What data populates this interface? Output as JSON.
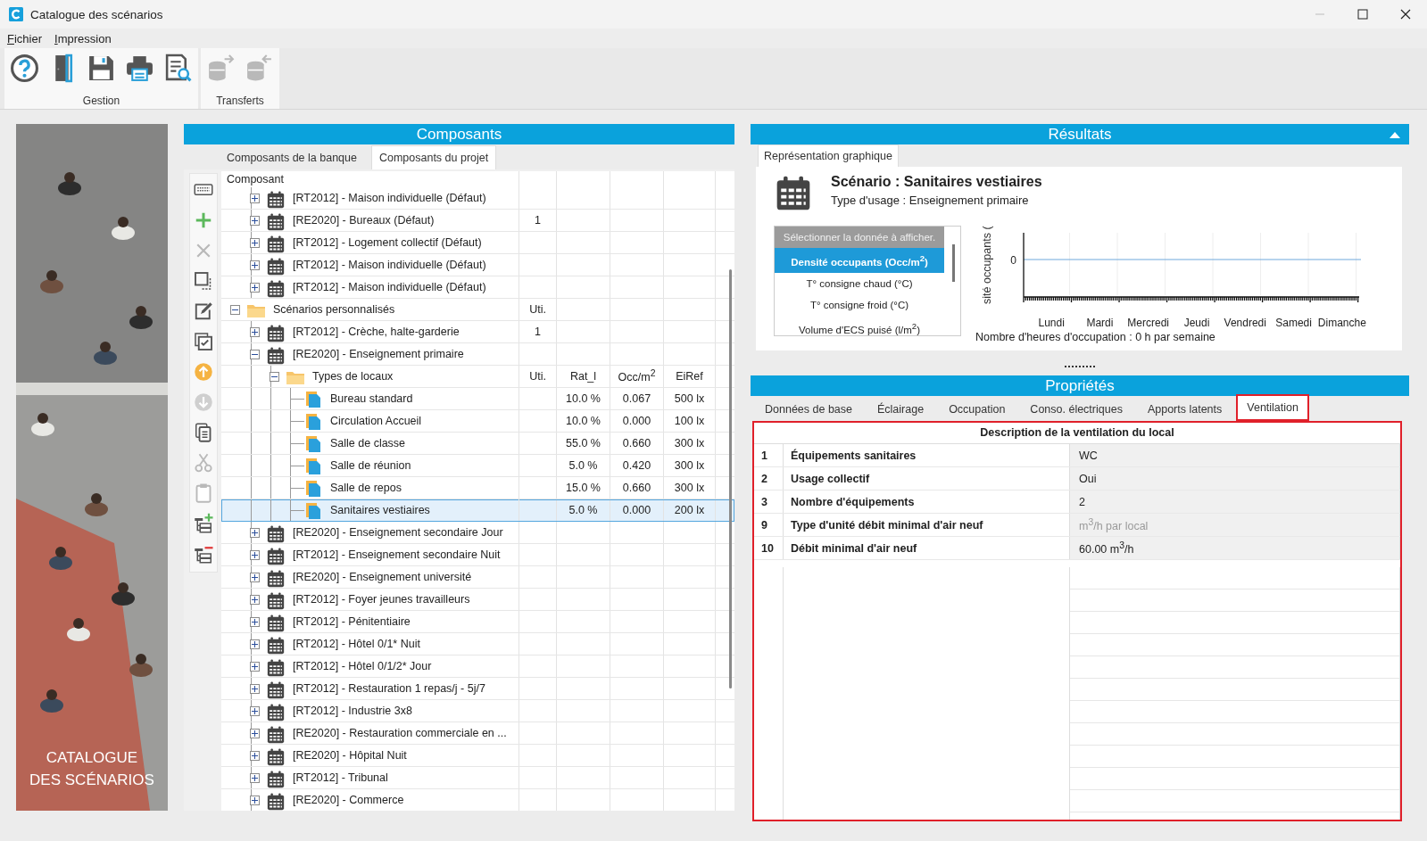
{
  "window": {
    "title": "Catalogue des scénarios"
  },
  "menu": [
    {
      "label": "Fichier"
    },
    {
      "label": "Impression"
    }
  ],
  "toolbar": [
    {
      "label": "Gestion",
      "tools": [
        {
          "kind": "help",
          "disabled": false
        },
        {
          "kind": "door",
          "disabled": false
        },
        {
          "kind": "save",
          "disabled": false
        },
        {
          "kind": "print",
          "disabled": false
        },
        {
          "kind": "preview",
          "disabled": false
        }
      ]
    },
    {
      "label": "Transferts",
      "tools": [
        {
          "kind": "export",
          "disabled": true
        },
        {
          "kind": "import",
          "disabled": true
        }
      ]
    }
  ],
  "side_banner": {
    "kind": "picture",
    "title_lines": [
      "CATALOGUE",
      "DES SCÉNARIOS"
    ]
  },
  "composants": {
    "title": "Composants",
    "tabs": [
      {
        "label": "Composants de la banque",
        "selected": false
      },
      {
        "label": "Composants du projet",
        "selected": true
      }
    ],
    "tools": [
      {
        "kind": "keyboard",
        "disabled": false
      },
      {
        "kind": "add",
        "disabled": false
      },
      {
        "kind": "delete",
        "disabled": true
      },
      {
        "kind": "select",
        "disabled": false
      },
      {
        "kind": "edit",
        "disabled": false
      },
      {
        "kind": "check",
        "disabled": false
      },
      {
        "kind": "up",
        "disabled": false
      },
      {
        "kind": "down",
        "disabled": true
      },
      {
        "kind": "copy",
        "disabled": false
      },
      {
        "kind": "cut",
        "disabled": true
      },
      {
        "kind": "paste",
        "disabled": true
      },
      {
        "kind": "tree-add",
        "disabled": false
      },
      {
        "kind": "tree-remove",
        "disabled": false
      }
    ],
    "tree": {
      "column_heading": "Composant",
      "top_items": [
        {
          "kind": "calendar",
          "label": "[RT2012] - Maison individuelle (Défaut)",
          "expanded": false,
          "selected": false
        },
        {
          "kind": "calendar",
          "label": "[RE2020] - Bureaux (Défaut)",
          "uti": "1",
          "expanded": false,
          "selected": false
        },
        {
          "kind": "calendar",
          "label": "[RT2012] - Logement collectif (Défaut)",
          "expanded": false,
          "selected": false
        },
        {
          "kind": "calendar",
          "label": "[RT2012] - Maison individuelle (Défaut)",
          "expanded": false,
          "selected": false
        },
        {
          "kind": "calendar",
          "label": "[RT2012] - Maison individuelle (Défaut)",
          "expanded": false,
          "selected": false
        }
      ],
      "folders": [
        {
          "kind": "folder",
          "label": "Scénarios personnalisés",
          "column_headings": [
            "Uti."
          ],
          "expanded": true,
          "selected": false,
          "children": [
            {
              "kind": "calendar",
              "label": "[RT2012] - Crèche, halte-garderie",
              "uti": "1",
              "expanded": false,
              "selected": false
            },
            {
              "kind": "calendar",
              "label": "[RE2020] - Enseignement primaire",
              "expanded": true,
              "selected": false,
              "children": [
                {
                  "kind": "folder",
                  "label": "Types de locaux",
                  "column_headings": [
                    "Uti.",
                    "Rat_l",
                    "Occ/m$^{2}$",
                    "EiRef"
                  ],
                  "expanded": true,
                  "selected": false,
                  "children": [
                    {
                      "kind": "local",
                      "label": "Bureau standard",
                      "rat_l": "10.0 %",
                      "occ_m2": "0.067",
                      "eiref": "500 lx",
                      "selected": false
                    },
                    {
                      "kind": "local",
                      "label": "Circulation Accueil",
                      "rat_l": "10.0 %",
                      "occ_m2": "0.000",
                      "eiref": "100 lx",
                      "selected": false
                    },
                    {
                      "kind": "local",
                      "label": "Salle de classe",
                      "rat_l": "55.0 %",
                      "occ_m2": "0.660",
                      "eiref": "300 lx",
                      "selected": false
                    },
                    {
                      "kind": "local",
                      "label": "Salle de réunion",
                      "rat_l": "5.0 %",
                      "occ_m2": "0.420",
                      "eiref": "300 lx",
                      "selected": false
                    },
                    {
                      "kind": "local",
                      "label": "Salle de repos",
                      "rat_l": "15.0 %",
                      "occ_m2": "0.660",
                      "eiref": "300 lx",
                      "selected": false
                    },
                    {
                      "kind": "local",
                      "label": "Sanitaires vestiaires",
                      "rat_l": "5.0 %",
                      "occ_m2": "0.000",
                      "eiref": "200 lx",
                      "selected": true
                    }
                  ]
                }
              ]
            },
            {
              "kind": "calendar",
              "label": "[RE2020] - Enseignement secondaire Jour",
              "expanded": false,
              "selected": false
            },
            {
              "kind": "calendar",
              "label": "[RT2012] - Enseignement secondaire Nuit",
              "expanded": false,
              "selected": false
            },
            {
              "kind": "calendar",
              "label": "[RE2020] - Enseignement université",
              "expanded": false,
              "selected": false
            },
            {
              "kind": "calendar",
              "label": "[RT2012] - Foyer jeunes travailleurs",
              "expanded": false,
              "selected": false
            },
            {
              "kind": "calendar",
              "label": "[RT2012] - Pénitentiaire",
              "expanded": false,
              "selected": false
            },
            {
              "kind": "calendar",
              "label": "[RT2012] - Hôtel 0/1* Nuit",
              "expanded": false,
              "selected": false
            },
            {
              "kind": "calendar",
              "label": "[RT2012] - Hôtel 0/1/2* Jour",
              "expanded": false,
              "selected": false
            },
            {
              "kind": "calendar",
              "label": "[RT2012] - Restauration 1 repas/j - 5j/7",
              "expanded": false,
              "selected": false
            },
            {
              "kind": "calendar",
              "label": "[RT2012] - Industrie 3x8",
              "expanded": false,
              "selected": false
            },
            {
              "kind": "calendar",
              "label": "[RE2020] - Restauration commerciale en ...",
              "expanded": false,
              "selected": false
            },
            {
              "kind": "calendar",
              "label": "[RE2020] - Hôpital Nuit",
              "expanded": false,
              "selected": false
            },
            {
              "kind": "calendar",
              "label": "[RT2012] - Tribunal",
              "expanded": false,
              "selected": false
            },
            {
              "kind": "calendar",
              "label": "[RE2020] - Commerce",
              "expanded": false,
              "selected": false
            }
          ]
        }
      ]
    }
  },
  "resultats": {
    "title": "Résultats",
    "tabs": [
      {
        "label": "Représentation graphique",
        "selected": true
      }
    ],
    "scenario_title": "Scénario : Sanitaires vestiaires",
    "usage": "Type d'usage : Enseignement primaire",
    "data_list": {
      "header": "Sélectionner la donnée à afficher.",
      "items": [
        {
          "label": "Densité occupants (Occ/m$^{2}$)",
          "selected": true
        },
        {
          "label": "T° consigne chaud (°C)",
          "selected": false
        },
        {
          "label": "T° consigne froid (°C)",
          "selected": false
        },
        {
          "label": "Volume d'ECS puisé (l/m$^{2}$)",
          "selected": false
        }
      ]
    },
    "chart": {
      "y_label": "sité occupants (",
      "y_tick": "0",
      "x_labels": [
        "Lundi",
        "Mardi",
        "Mercredi",
        "Jeudi",
        "Vendredi",
        "Samedi",
        "Dimanche"
      ],
      "footer": "Nombre d'heures d'occupation : 0 h par semaine"
    }
  },
  "proprietes": {
    "title": "Propriétés",
    "tabs": [
      {
        "label": "Données de base",
        "selected": false,
        "highlighted": false
      },
      {
        "label": "Éclairage",
        "selected": false,
        "highlighted": false
      },
      {
        "label": "Occupation",
        "selected": false,
        "highlighted": false
      },
      {
        "label": "Conso. électriques",
        "selected": false,
        "highlighted": false
      },
      {
        "label": "Apports latents",
        "selected": false,
        "highlighted": false
      },
      {
        "label": "Ventilation",
        "selected": true,
        "highlighted": true
      }
    ],
    "table": {
      "title": "Description de la ventilation du local",
      "highlighted": true,
      "rows": [
        {
          "num": "1",
          "label": "Équipements sanitaires",
          "value": "WC",
          "disabled": false
        },
        {
          "num": "2",
          "label": "Usage collectif",
          "value": "Oui",
          "disabled": false
        },
        {
          "num": "3",
          "label": "Nombre d'équipements",
          "value": "2",
          "disabled": false
        },
        {
          "num": "9",
          "label": "Type d'unité débit minimal d'air neuf",
          "value": "m$^{3}$/h par local",
          "disabled": true
        },
        {
          "num": "10",
          "label": "Débit minimal d'air neuf",
          "value": "60.00 m$^{3}$/h",
          "disabled": false
        }
      ]
    }
  }
}
